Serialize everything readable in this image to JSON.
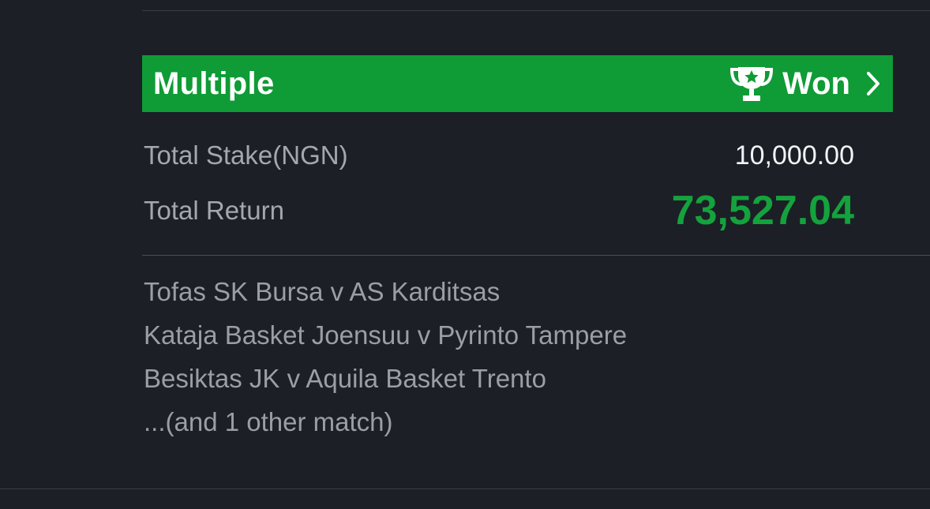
{
  "bet": {
    "type": "Multiple",
    "status": "Won",
    "status_icon": "trophy-icon",
    "chevron_icon": "chevron-right-icon"
  },
  "totals": {
    "stake_label": "Total Stake(NGN)",
    "stake_value": "10,000.00",
    "return_label": "Total Return",
    "return_value": "73,527.04"
  },
  "matches": [
    "Tofas SK Bursa v AS Karditsas",
    "Kataja Basket Joensuu v Pyrinto Tampere",
    "Besiktas JK v Aquila Basket Trento",
    "...(and 1 other match)"
  ],
  "colors": {
    "background": "#1c1f26",
    "header_green": "#0f9b35",
    "return_green": "#14a23d",
    "label_gray": "#a3a7b0"
  }
}
